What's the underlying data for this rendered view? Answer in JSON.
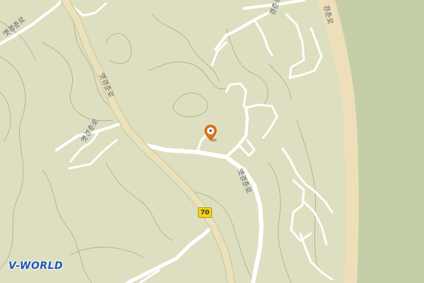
{
  "map": {
    "provider_logo": "V-WORLD",
    "route_shield": "70",
    "road_labels": [
      "옛경춘로",
      "옛경춘로",
      "옛경춘로",
      "옛경춘로",
      "경춘로",
      "경춘로"
    ],
    "marker": {
      "icon": "map-pin-icon",
      "color": "#e8731a"
    },
    "colors": {
      "land": "#dedfc1",
      "river": "#c4cfa7",
      "riverbank": "#eedfba",
      "road": "#ffffff",
      "main_road": "#ebe1bb",
      "contour": "#a9aa8b"
    }
  }
}
